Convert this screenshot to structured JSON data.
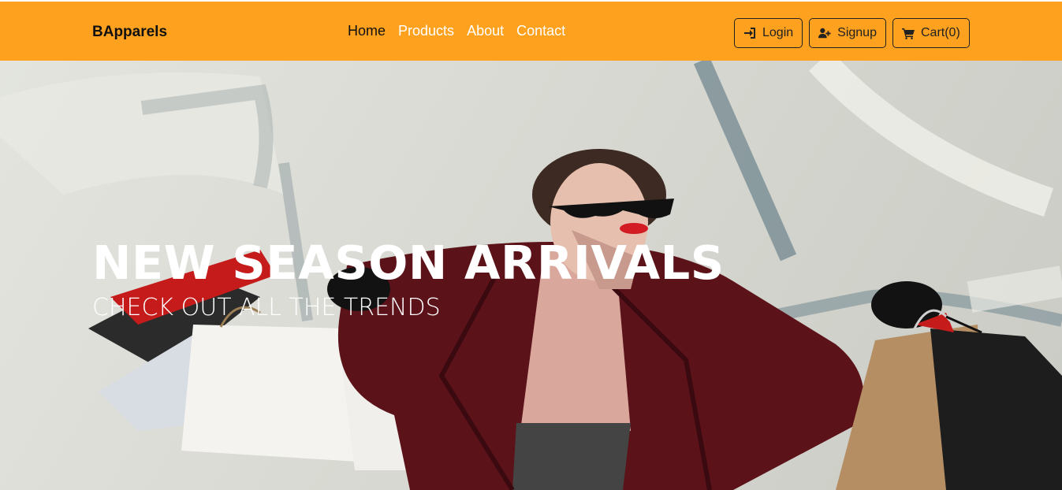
{
  "brand": "BApparels",
  "nav": {
    "links": [
      {
        "label": "Home",
        "active": true
      },
      {
        "label": "Products",
        "active": false
      },
      {
        "label": "About",
        "active": false
      },
      {
        "label": "Contact",
        "active": false
      }
    ],
    "buttons": [
      {
        "label": "Login",
        "icon": "sign-in-icon"
      },
      {
        "label": "Signup",
        "icon": "user-plus-icon"
      },
      {
        "label": "Cart(0)",
        "icon": "cart-icon"
      }
    ]
  },
  "hero": {
    "title": "NEW SEASON ARRIVALS",
    "subtitle": "CHECK OUT ALL THE TRENDS"
  },
  "colors": {
    "navbar": "#fea11e",
    "nav_text": "#ffffff",
    "nav_active": "#111111"
  }
}
